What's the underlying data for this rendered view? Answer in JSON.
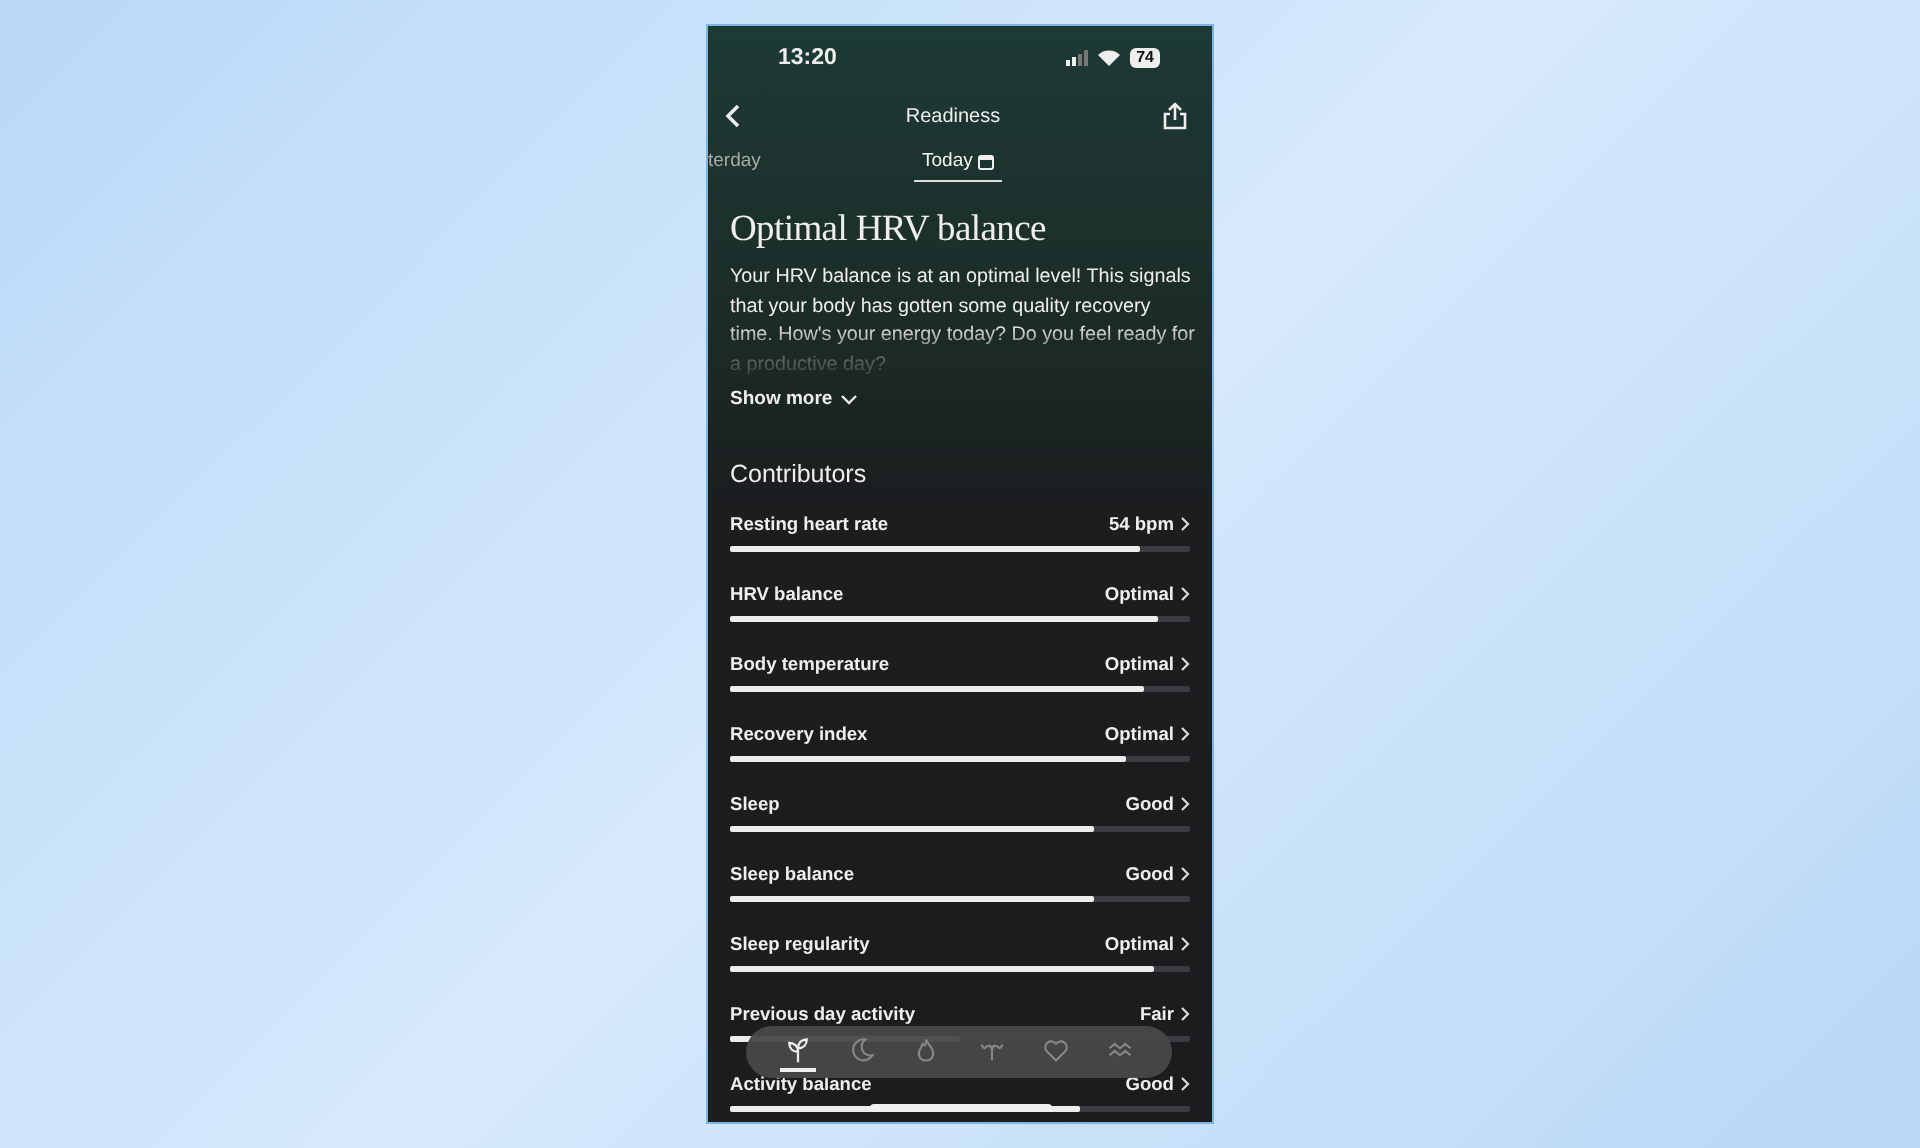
{
  "status_bar": {
    "time": "13:20",
    "battery": "74"
  },
  "header": {
    "title": "Readiness"
  },
  "tabs": [
    {
      "label": "terday",
      "selected": false
    },
    {
      "label": "Today",
      "selected": true
    }
  ],
  "summary": {
    "title": "Optimal HRV balance",
    "text": "Your HRV balance is at an optimal level! This signals that your body has gotten some quality recovery time. How's your energy today? Do you feel ready for a productive day?",
    "toggle": "Show more"
  },
  "contributors": {
    "title": "Contributors",
    "items": [
      {
        "label": "Resting heart rate",
        "value": "54 bpm",
        "level": 0.89
      },
      {
        "label": "HRV balance",
        "value": "Optimal",
        "level": 0.93
      },
      {
        "label": "Body temperature",
        "value": "Optimal",
        "level": 0.9
      },
      {
        "label": "Recovery index",
        "value": "Optimal",
        "level": 0.86
      },
      {
        "label": "Sleep",
        "value": "Good",
        "level": 0.79
      },
      {
        "label": "Sleep balance",
        "value": "Good",
        "level": 0.79
      },
      {
        "label": "Sleep regularity",
        "value": "Optimal",
        "level": 0.92
      },
      {
        "label": "Previous day activity",
        "value": "Fair",
        "level": 0.5
      },
      {
        "label": "Activity balance",
        "value": "Good",
        "level": 0.76
      }
    ]
  },
  "nav": [
    {
      "kind": "sprout",
      "selected": true
    },
    {
      "kind": "moon",
      "selected": false
    },
    {
      "kind": "flame",
      "selected": false
    },
    {
      "kind": "branch",
      "selected": false
    },
    {
      "kind": "heart",
      "selected": false
    },
    {
      "kind": "waves",
      "selected": false
    }
  ]
}
